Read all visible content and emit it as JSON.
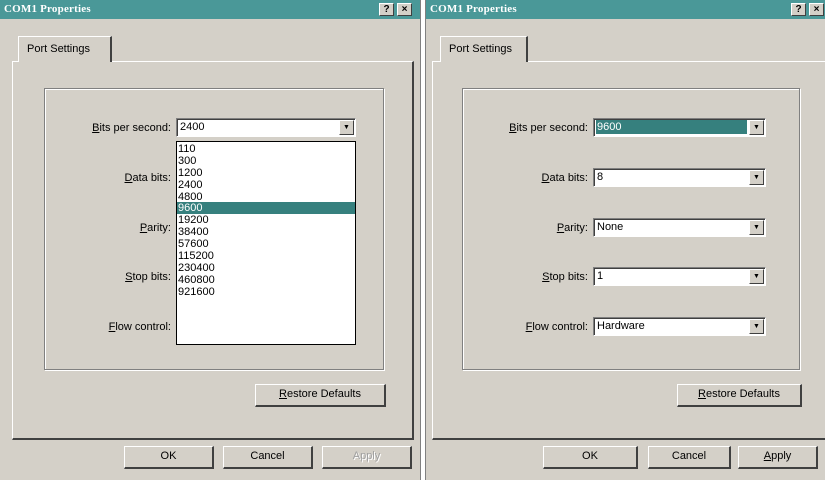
{
  "dialogs": [
    {
      "title": "COM1 Properties",
      "help_button": "?",
      "close_button": "×",
      "tab_label": "Port Settings",
      "fields": {
        "bits_per_second": {
          "label_ul": "B",
          "label_rest": "its per second:",
          "value": "2400"
        },
        "data_bits": {
          "label_ul": "D",
          "label_rest": "ata bits:",
          "value": ""
        },
        "parity": {
          "label_ul": "P",
          "label_rest": "arity:",
          "value": ""
        },
        "stop_bits": {
          "label_ul": "S",
          "label_rest": "top bits:",
          "value": ""
        },
        "flow_control": {
          "label_ul": "F",
          "label_rest": "low control:",
          "value": ""
        }
      },
      "dropdown_open": true,
      "dropdown_options": [
        "110",
        "300",
        "1200",
        "2400",
        "4800",
        "9600",
        "19200",
        "38400",
        "57600",
        "115200",
        "230400",
        "460800",
        "921600"
      ],
      "dropdown_highlighted": "9600",
      "restore_defaults": {
        "ul": "R",
        "rest": "estore Defaults"
      },
      "ok_label": "OK",
      "cancel_label": "Cancel",
      "apply_label": "Apply",
      "apply_enabled": false
    },
    {
      "title": "COM1 Properties",
      "help_button": "?",
      "close_button": "×",
      "tab_label": "Port Settings",
      "fields": {
        "bits_per_second": {
          "label_ul": "B",
          "label_rest": "its per second:",
          "value": "9600"
        },
        "data_bits": {
          "label_ul": "D",
          "label_rest": "ata bits:",
          "value": "8"
        },
        "parity": {
          "label_ul": "P",
          "label_rest": "arity:",
          "value": "None"
        },
        "stop_bits": {
          "label_ul": "S",
          "label_rest": "top bits:",
          "value": "1"
        },
        "flow_control": {
          "label_ul": "F",
          "label_rest": "low control:",
          "value": "Hardware"
        }
      },
      "dropdown_open": false,
      "restore_defaults": {
        "ul": "R",
        "rest": "estore Defaults"
      },
      "ok_label": "OK",
      "cancel_label": "Cancel",
      "apply_label": "Apply",
      "apply_enabled": true
    }
  ],
  "colors": {
    "titlebar": "#4a9898",
    "selection": "#36807e",
    "face": "#d4d0c8"
  }
}
